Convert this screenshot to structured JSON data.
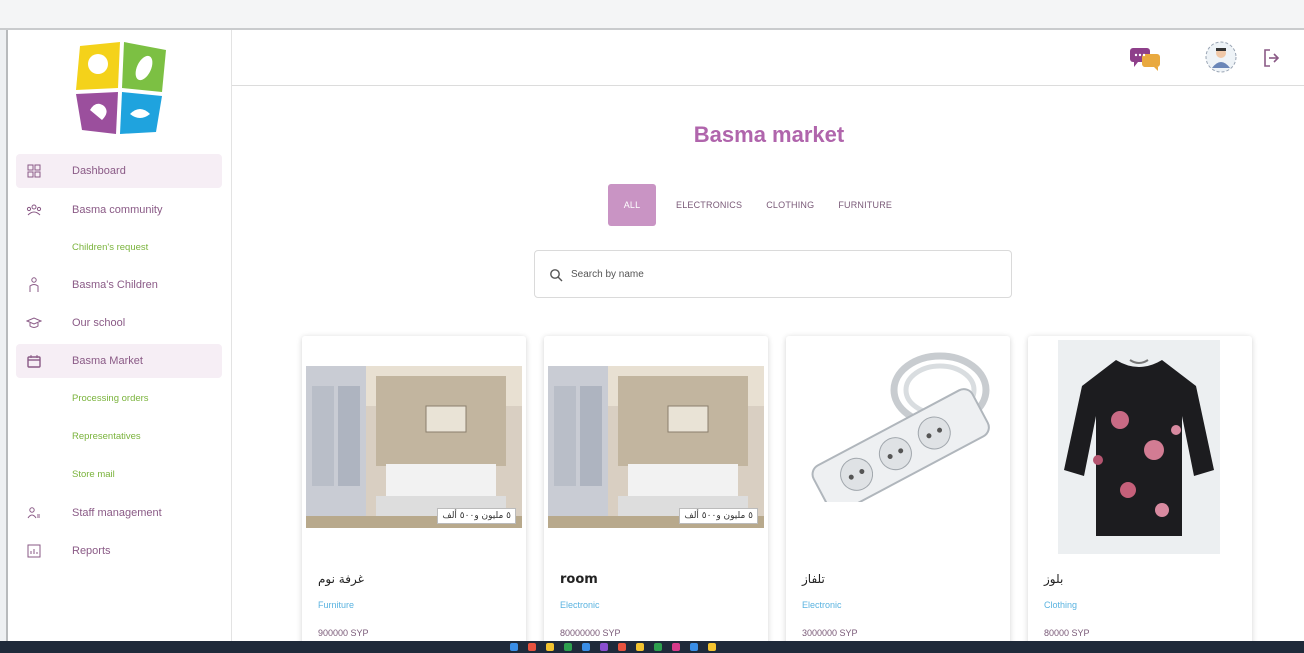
{
  "sidebar": {
    "items": [
      {
        "label": "Dashboard",
        "icon": "dashboard-icon",
        "active": true
      },
      {
        "label": "Basma community",
        "icon": "community-icon"
      },
      {
        "label": "Basma's Children",
        "icon": "children-icon"
      },
      {
        "label": "Our school",
        "icon": "school-icon"
      },
      {
        "label": "Basma Market",
        "icon": "market-icon",
        "active": true
      },
      {
        "label": "Staff management",
        "icon": "staff-icon"
      },
      {
        "label": "Reports",
        "icon": "reports-icon"
      }
    ],
    "sub_items": {
      "community": [
        "Children's request"
      ],
      "market": [
        "Processing orders",
        "Representatives",
        "Store mail"
      ]
    }
  },
  "header": {
    "icons": [
      "chat-icon",
      "profile-avatar-icon",
      "logout-icon"
    ]
  },
  "main": {
    "title": "Basma market",
    "tabs": [
      {
        "label": "ALL",
        "active": true
      },
      {
        "label": "ELECTRONICS"
      },
      {
        "label": "CLOTHING"
      },
      {
        "label": "FURNITURE"
      }
    ],
    "search": {
      "placeholder": "Search by name"
    },
    "products": [
      {
        "name": "غرفة نوم",
        "category": "Furniture",
        "price": "900000 SYP",
        "price_tag": "٥ مليون و٥٠٠ ألف",
        "image": "bedroom"
      },
      {
        "name": "room",
        "category": "Electronic",
        "price": "80000000 SYP",
        "price_tag": "٥ مليون و٥٠٠ ألف",
        "image": "bedroom"
      },
      {
        "name": "تلفاز",
        "category": "Electronic",
        "price": "3000000 SYP",
        "image": "power-strip"
      },
      {
        "name": "بلوز",
        "category": "Clothing",
        "price": "80000 SYP",
        "image": "blouse"
      }
    ]
  },
  "colors": {
    "accent": "#b065ac",
    "tab_active": "#c994c4",
    "sub_item": "#7ab33c",
    "category": "#5ab3e0"
  }
}
